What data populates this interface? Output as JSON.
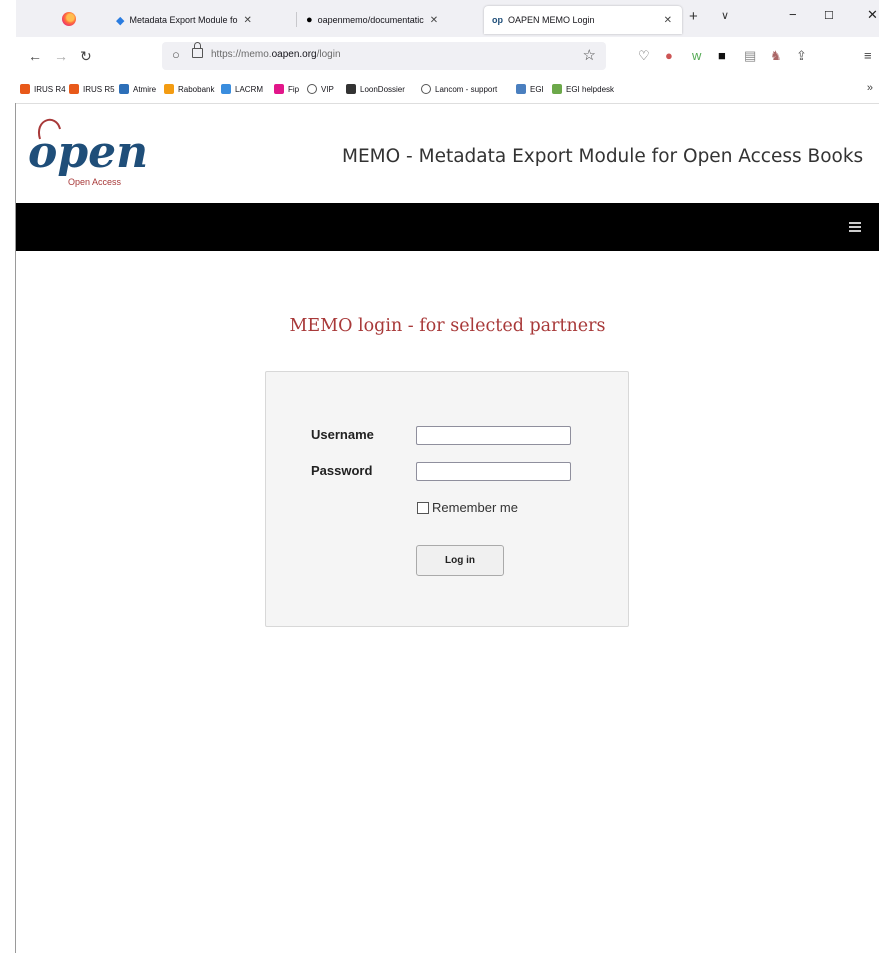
{
  "browser": {
    "tabs": [
      {
        "title": "Metadata Export Module fo",
        "icon": "diamond-icon"
      },
      {
        "title": "oapenmemo/documentatic",
        "icon": "github-icon"
      },
      {
        "title": "OAPEN MEMO Login",
        "icon": "oapen-favicon",
        "active": true
      }
    ],
    "url_prefix": "https://memo.",
    "url_domain": "oapen.org",
    "url_path": "/login",
    "bookmarks": [
      "IRUS R4",
      "IRUS R5",
      "Atmire",
      "Rabobank",
      "LACRM",
      "Fip",
      "VIP",
      "LoonDossier",
      "Lancom - support",
      "EGI",
      "EGI helpdesk"
    ]
  },
  "header": {
    "logo_text": "Open Access",
    "title": "MEMO - Metadata Export Module for Open Access Books"
  },
  "login": {
    "heading": "MEMO login - for selected partners",
    "username_label": "Username",
    "password_label": "Password",
    "username_value": "",
    "password_value": "",
    "remember_label": "Remember me",
    "remember_checked": false,
    "submit_label": "Log in"
  },
  "colors": {
    "heading": "#a83939",
    "logo_blue": "#1f4e79",
    "logo_red": "#a83939",
    "navbar": "#000000"
  }
}
